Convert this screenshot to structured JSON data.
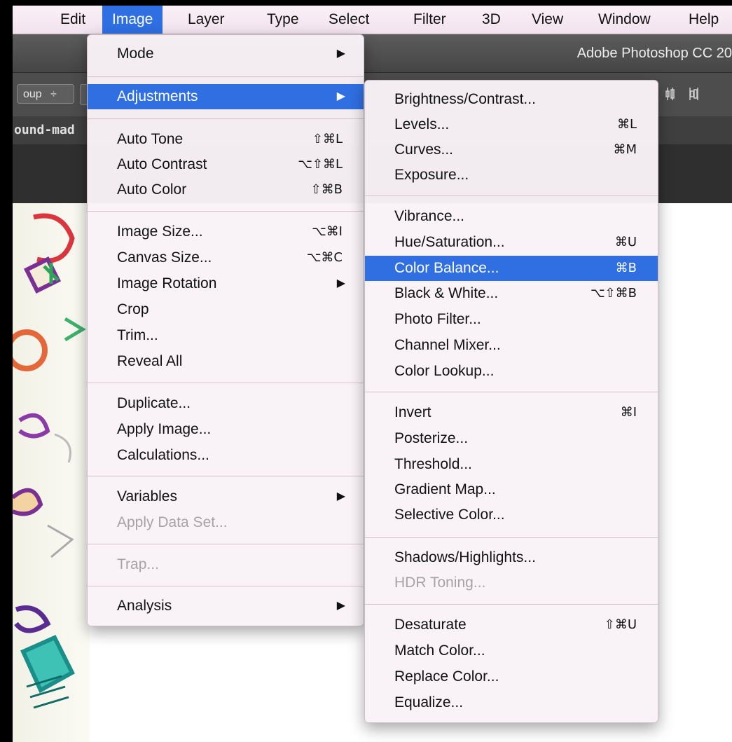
{
  "menubar": {
    "items": [
      "Edit",
      "Image",
      "Layer",
      "Type",
      "Select",
      "Filter",
      "3D",
      "View",
      "Window",
      "Help"
    ],
    "active": "Image"
  },
  "app": {
    "title": "Adobe Photoshop CC 20",
    "tool_preset": "oup",
    "tool_preset_arrow": "÷",
    "doc_tab": "ound-mad",
    "align_icons": [
      "align-center-icon",
      "align-right-icon"
    ]
  },
  "image_menu": {
    "items": [
      {
        "label": "Mode",
        "submenu": true
      },
      {
        "label": "Adjustments",
        "submenu": true,
        "highlighted": true
      },
      {
        "label": "Auto Tone",
        "shortcut": "⇧⌘L"
      },
      {
        "label": "Auto Contrast",
        "shortcut": "⌥⇧⌘L"
      },
      {
        "label": "Auto Color",
        "shortcut": "⇧⌘B"
      },
      {
        "label": "Image Size...",
        "shortcut": "⌥⌘I"
      },
      {
        "label": "Canvas Size...",
        "shortcut": "⌥⌘C"
      },
      {
        "label": "Image Rotation",
        "submenu": true
      },
      {
        "label": "Crop"
      },
      {
        "label": "Trim..."
      },
      {
        "label": "Reveal All"
      },
      {
        "label": "Duplicate..."
      },
      {
        "label": "Apply Image..."
      },
      {
        "label": "Calculations..."
      },
      {
        "label": "Variables",
        "submenu": true
      },
      {
        "label": "Apply Data Set...",
        "disabled": true
      },
      {
        "label": "Trap...",
        "disabled": true
      },
      {
        "label": "Analysis",
        "submenu": true
      }
    ]
  },
  "adjustments_menu": {
    "items": [
      {
        "label": "Brightness/Contrast..."
      },
      {
        "label": "Levels...",
        "shortcut": "⌘L"
      },
      {
        "label": "Curves...",
        "shortcut": "⌘M"
      },
      {
        "label": "Exposure..."
      },
      {
        "label": "Vibrance..."
      },
      {
        "label": "Hue/Saturation...",
        "shortcut": "⌘U"
      },
      {
        "label": "Color Balance...",
        "shortcut": "⌘B",
        "highlighted": true
      },
      {
        "label": "Black & White...",
        "shortcut": "⌥⇧⌘B"
      },
      {
        "label": "Photo Filter..."
      },
      {
        "label": "Channel Mixer..."
      },
      {
        "label": "Color Lookup..."
      },
      {
        "label": "Invert",
        "shortcut": "⌘I"
      },
      {
        "label": "Posterize..."
      },
      {
        "label": "Threshold..."
      },
      {
        "label": "Gradient Map..."
      },
      {
        "label": "Selective Color..."
      },
      {
        "label": "Shadows/Highlights..."
      },
      {
        "label": "HDR Toning...",
        "disabled": true
      },
      {
        "label": "Desaturate",
        "shortcut": "⇧⌘U"
      },
      {
        "label": "Match Color..."
      },
      {
        "label": "Replace Color..."
      },
      {
        "label": "Equalize..."
      }
    ]
  },
  "colors": {
    "highlight": "#2f6fe2",
    "menu_bg": "#f9f3f8",
    "disabled_text": "#a8a2a7"
  }
}
